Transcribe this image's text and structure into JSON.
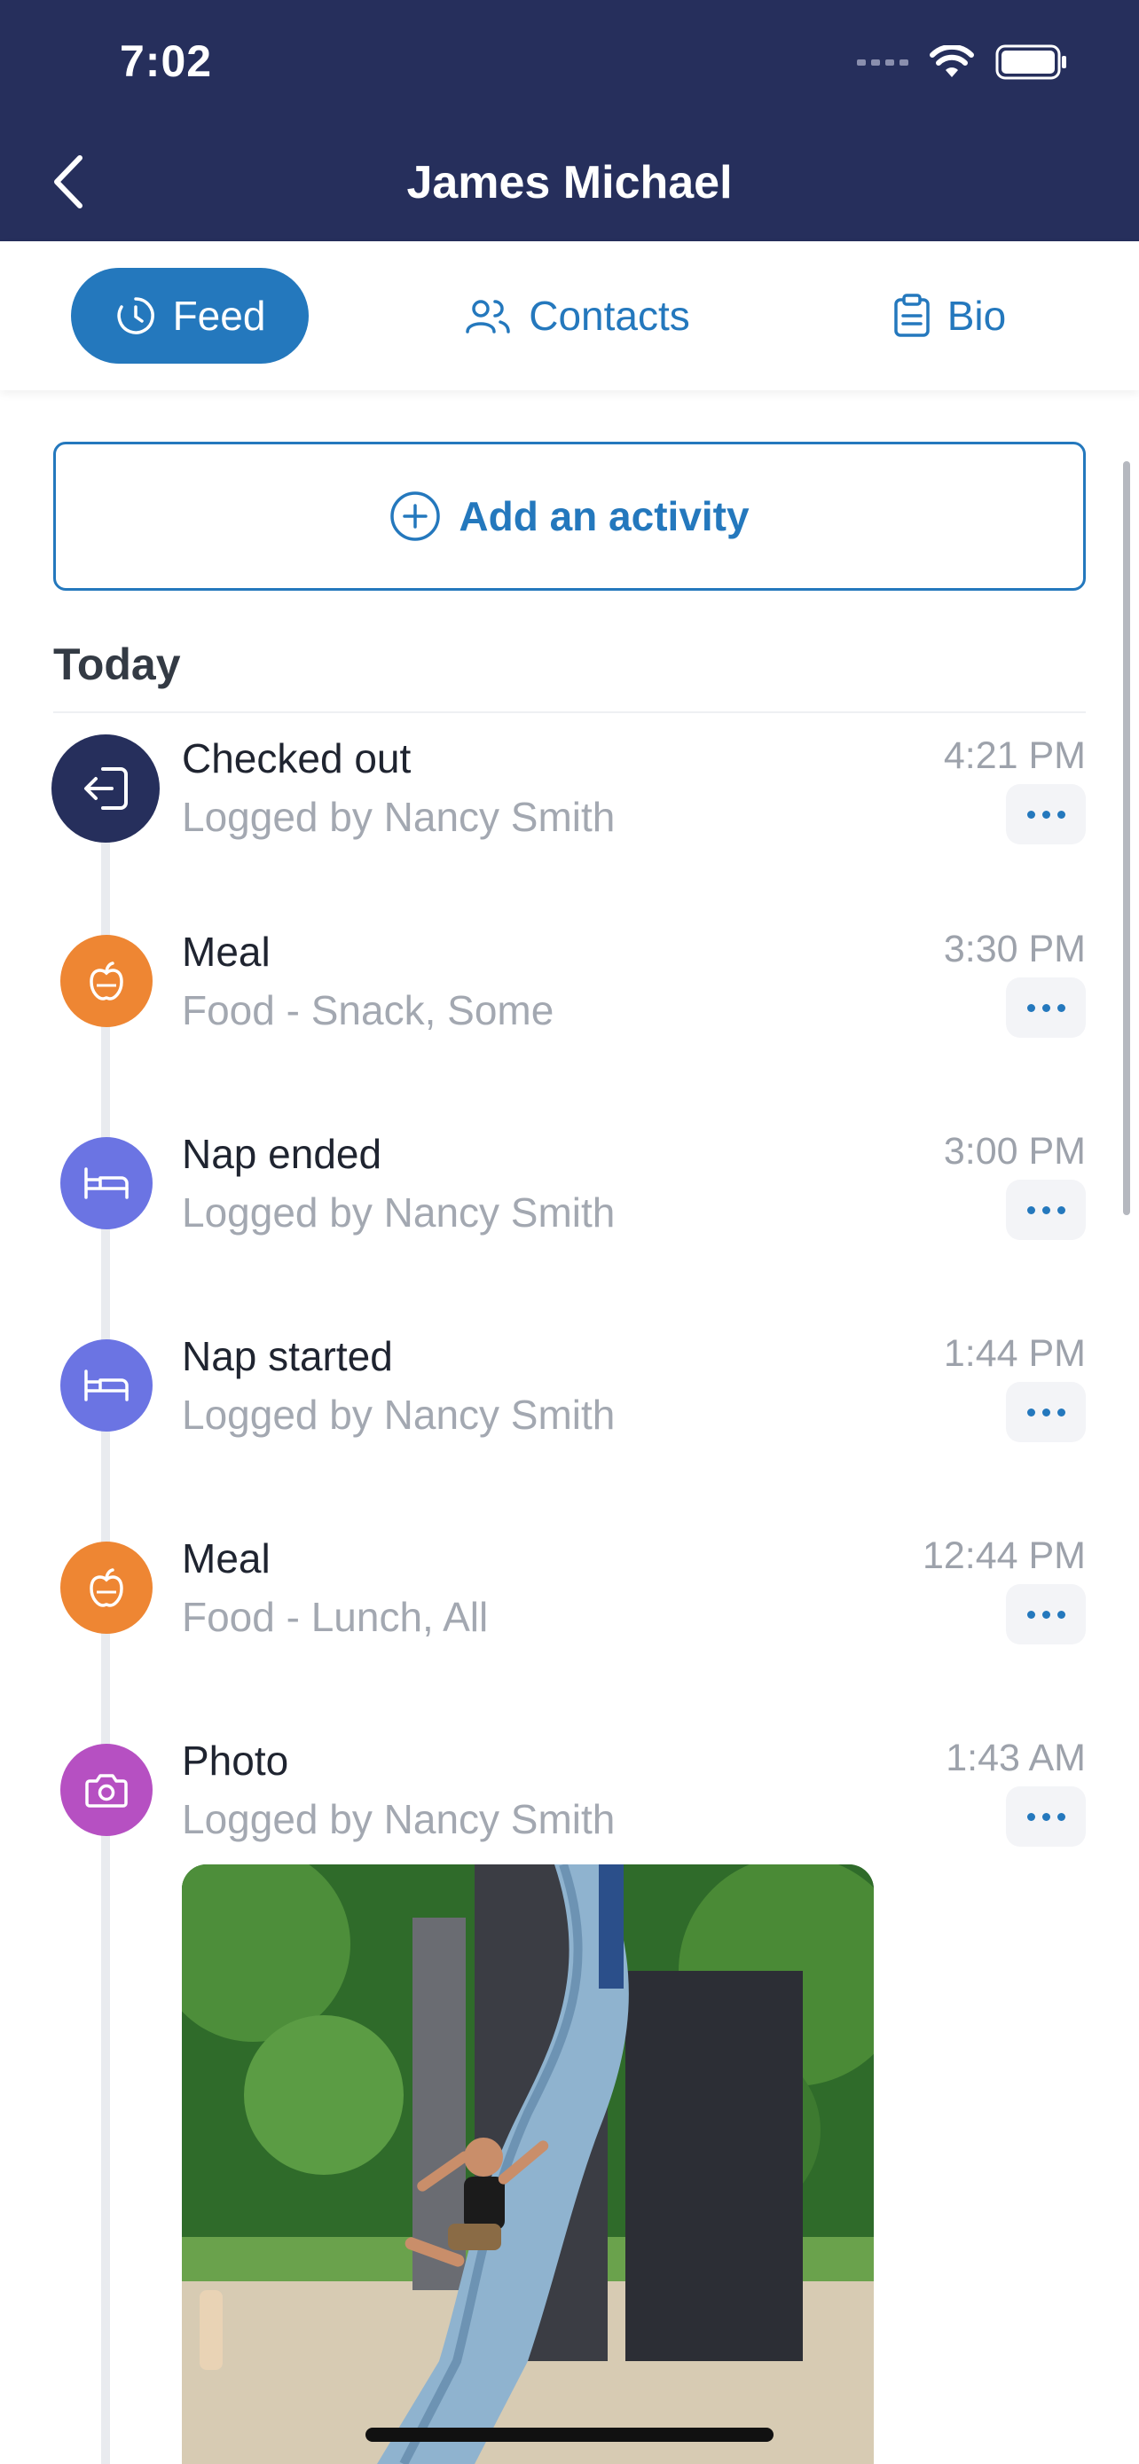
{
  "status_bar": {
    "time": "7:02"
  },
  "header": {
    "title": "James Michael",
    "back_icon": "chevron-left-icon"
  },
  "tabs": [
    {
      "label": "Feed",
      "icon": "clock-icon",
      "active": true
    },
    {
      "label": "Contacts",
      "icon": "people-icon",
      "active": false
    },
    {
      "label": "Bio",
      "icon": "clipboard-icon",
      "active": false
    }
  ],
  "add_activity": {
    "label": "Add an activity",
    "icon": "plus-circle-icon"
  },
  "section": {
    "title": "Today"
  },
  "feed": [
    {
      "title": "Checked out",
      "subtitle": "Logged by Nancy Smith",
      "time": "4:21 PM",
      "icon": "checkout-icon",
      "color": "#262f5c"
    },
    {
      "title": "Meal",
      "subtitle": "Food - Snack, Some",
      "time": "3:30 PM",
      "icon": "apple-icon",
      "color": "#ee8633"
    },
    {
      "title": "Nap ended",
      "subtitle": "Logged by Nancy Smith",
      "time": "3:00 PM",
      "icon": "bed-icon",
      "color": "#6b74e3"
    },
    {
      "title": "Nap started",
      "subtitle": "Logged by Nancy Smith",
      "time": "1:44 PM",
      "icon": "bed-icon",
      "color": "#6b74e3"
    },
    {
      "title": "Meal",
      "subtitle": "Food - Lunch, All",
      "time": "12:44 PM",
      "icon": "apple-icon",
      "color": "#ee8633"
    },
    {
      "title": "Photo",
      "subtitle": "Logged by Nancy Smith",
      "time": "1:43 AM",
      "icon": "camera-icon",
      "color": "#b650c2"
    }
  ],
  "colors": {
    "navy": "#262f5c",
    "accent": "#2478bd"
  }
}
